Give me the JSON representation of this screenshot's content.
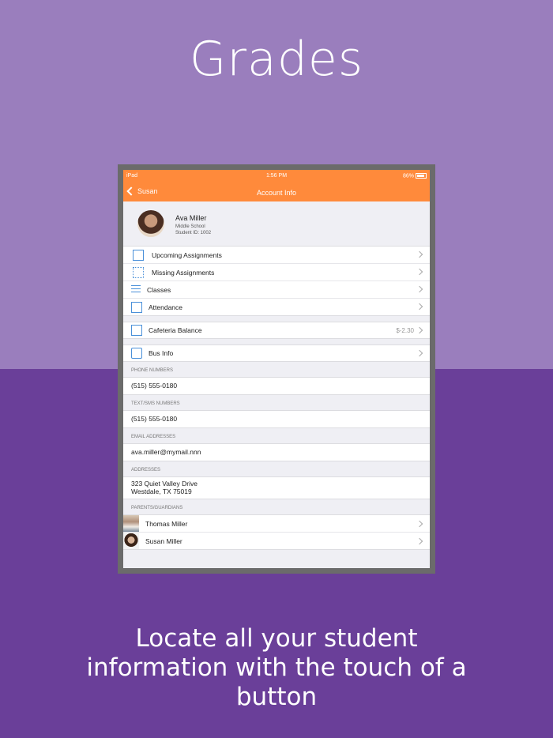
{
  "headline": "Grades",
  "tagline": "Locate all your student information with the touch of a button",
  "colors": {
    "bg_top": "#9a7ebd",
    "bg_bottom": "#6a3f99",
    "accent": "#ff8a3b",
    "icon_blue": "#4a90d9"
  },
  "status_bar": {
    "device": "iPad",
    "time": "1:56 PM",
    "battery": "86%"
  },
  "nav": {
    "back_label": "Susan",
    "title": "Account Info"
  },
  "student": {
    "name": "Ava Miller",
    "school": "Middle School",
    "student_id": "Student ID: 1002"
  },
  "menu": [
    {
      "label": "Upcoming Assignments",
      "icon": "document-icon"
    },
    {
      "label": "Missing Assignments",
      "icon": "document-dotted-icon"
    },
    {
      "label": "Classes",
      "icon": "list-icon"
    },
    {
      "label": "Attendance",
      "icon": "calendar-check-icon"
    }
  ],
  "cafeteria": {
    "label": "Cafeteria Balance",
    "value": "$-2.30",
    "icon": "card-icon"
  },
  "bus": {
    "label": "Bus Info",
    "icon": "bus-icon"
  },
  "phone": {
    "header": "PHONE NUMBERS",
    "value": "(515) 555-0180"
  },
  "sms": {
    "header": "TEXT/SMS NUMBERS",
    "value": "(515) 555-0180"
  },
  "email": {
    "header": "EMAIL ADDRESSES",
    "value": "ava.miller@mymail.nnn"
  },
  "address": {
    "header": "ADDRESSES",
    "line1": "323 Quiet Valley Drive",
    "line2": "Westdale, TX 75019"
  },
  "guardians": {
    "header": "PARENTS/GUARDIANS",
    "items": [
      {
        "name": "Thomas Miller"
      },
      {
        "name": "Susan Miller"
      }
    ]
  }
}
